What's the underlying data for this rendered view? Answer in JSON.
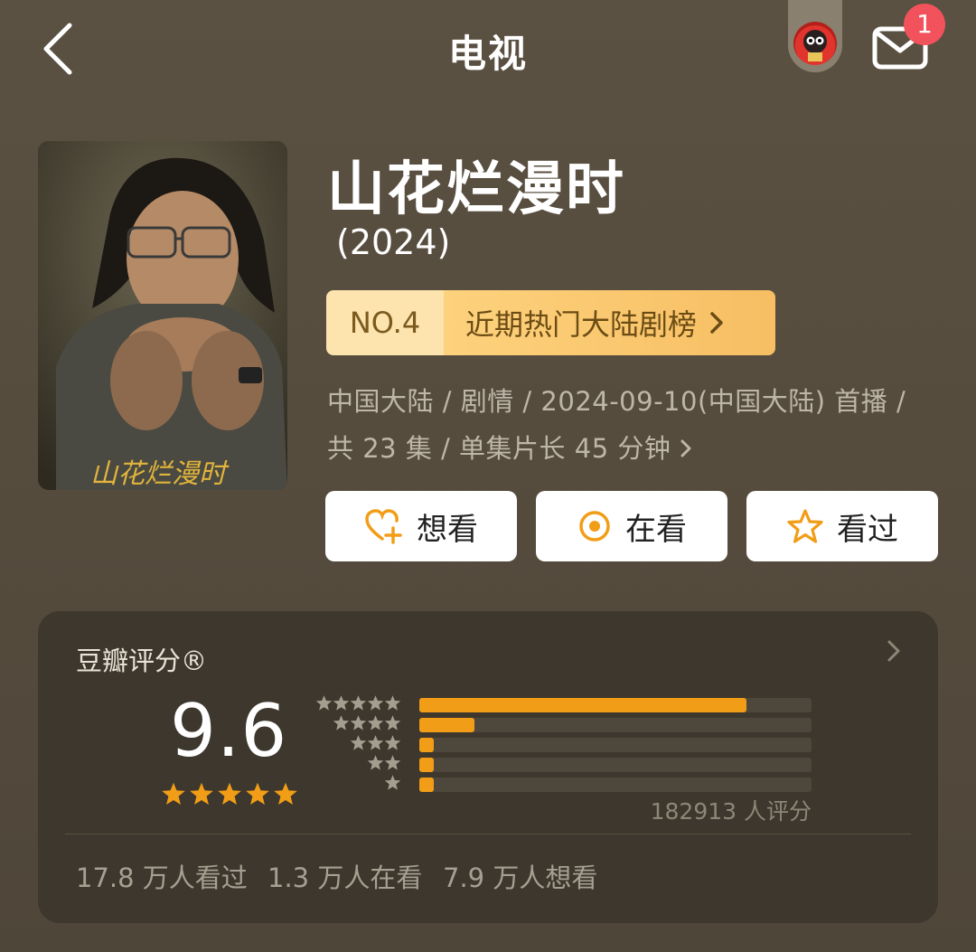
{
  "topbar": {
    "title": "电视",
    "notification_count": "1"
  },
  "show": {
    "title": "山花烂漫时",
    "year": "(2024)",
    "poster_text": "山花烂漫时",
    "rank": {
      "no": "NO.4",
      "label": "近期热门大陆剧榜"
    },
    "meta_line1": "中国大陆 / 剧情 / 2024-09-10(中国大陆) 首播 /",
    "meta_line2": "共 23 集 / 单集片长 45 分钟"
  },
  "actions": {
    "want": "想看",
    "watching": "在看",
    "watched": "看过"
  },
  "rating": {
    "title": "豆瓣评分®",
    "score": "9.6",
    "count_text": "182913 人评分",
    "distribution": [
      {
        "stars": 5,
        "fraction": 0.835
      },
      {
        "stars": 4,
        "fraction": 0.14
      },
      {
        "stars": 3,
        "fraction": 0.02
      },
      {
        "stars": 2,
        "fraction": 0.01
      },
      {
        "stars": 1,
        "fraction": 0.01
      }
    ],
    "stats": {
      "watched": "17.8 万人看过",
      "watching": "1.3 万人在看",
      "want": "7.9 万人想看"
    }
  },
  "colors": {
    "accent": "#f29d17",
    "badge": "#f2525b",
    "rank_bg": "#fdd27d"
  }
}
